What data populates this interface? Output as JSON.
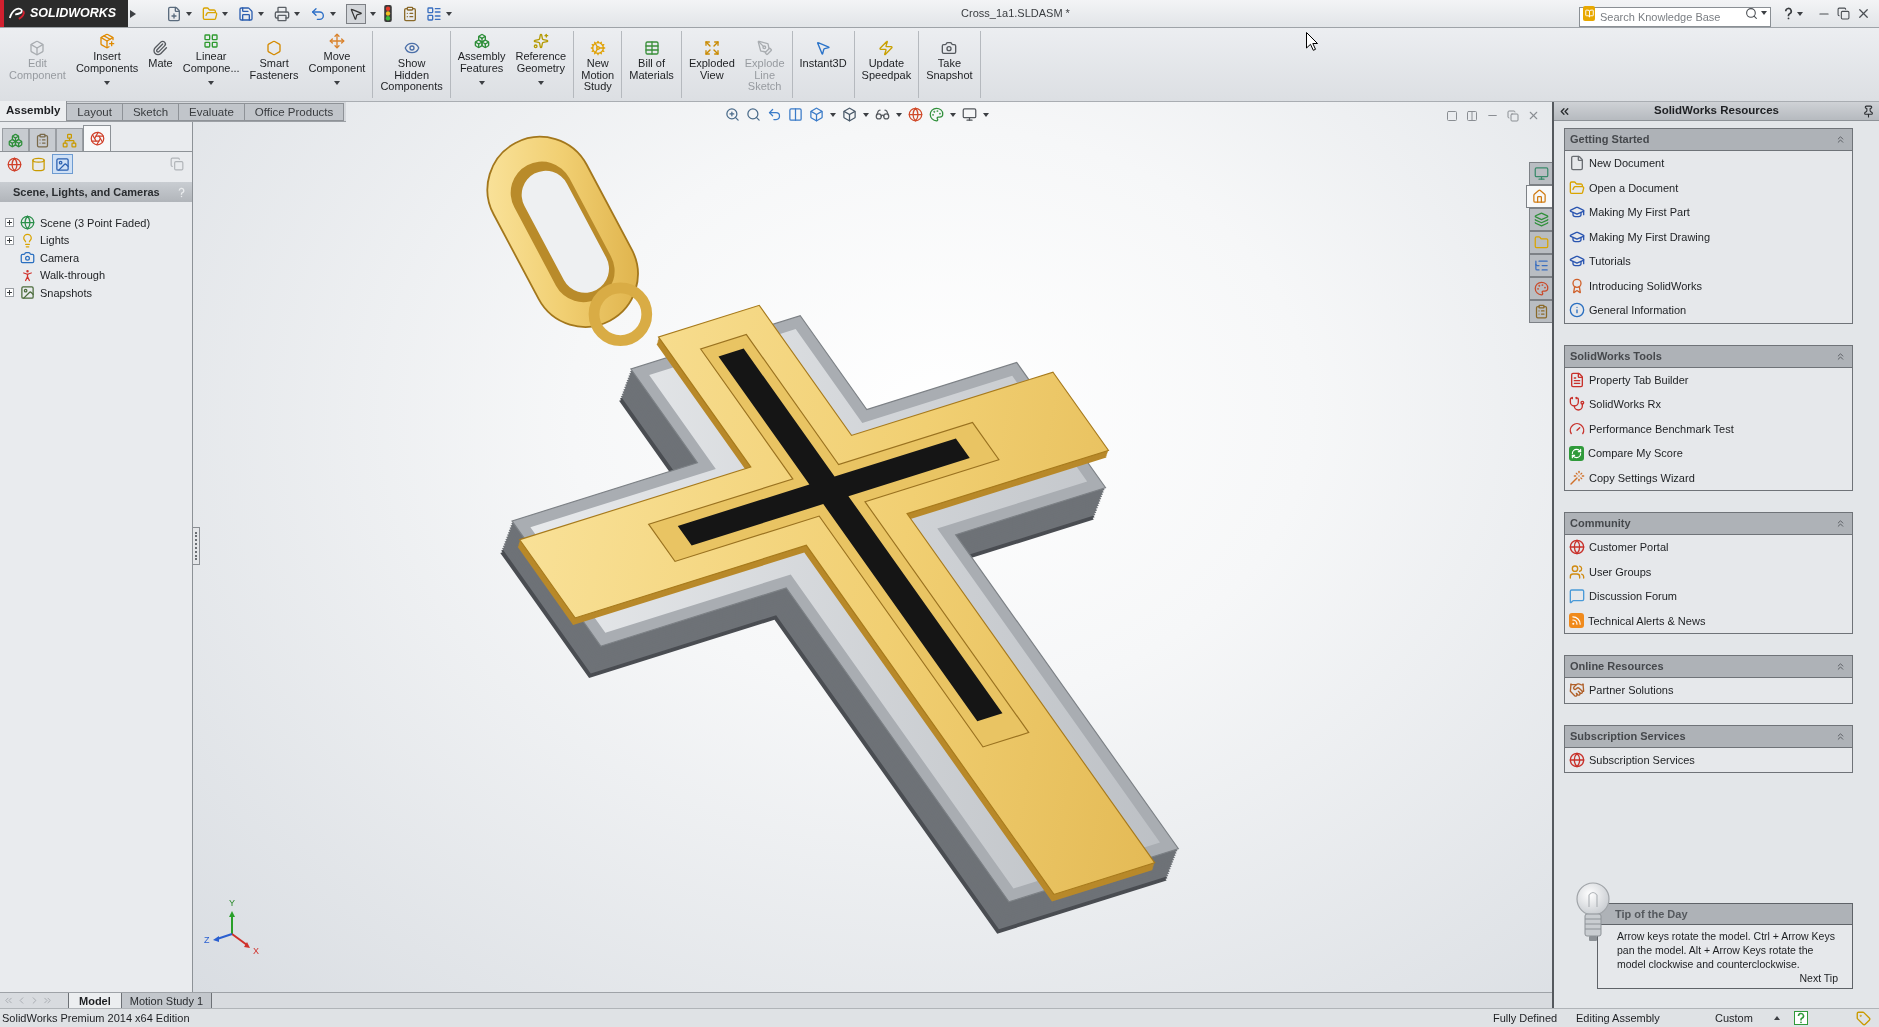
{
  "title_bar": {
    "logo": "SOLIDWORKS",
    "title": "Cross_1a1.SLDASM *",
    "select_tool": {
      "selected": true
    },
    "search": {
      "placeholder": "Search Knowledge Base"
    }
  },
  "command_groups": [
    {
      "buttons": [
        {
          "label": [
            "Edit",
            "Component"
          ],
          "disabled": true,
          "dropdown": false
        },
        {
          "label": [
            "Insert",
            "Components"
          ],
          "disabled": false,
          "dropdown": true
        },
        {
          "label": [
            "Mate"
          ],
          "disabled": false,
          "dropdown": false
        },
        {
          "label": [
            "Linear",
            "Compone..."
          ],
          "disabled": false,
          "dropdown": true
        },
        {
          "label": [
            "Smart",
            "Fasteners"
          ],
          "disabled": false,
          "dropdown": false
        },
        {
          "label": [
            "Move",
            "Component"
          ],
          "disabled": false,
          "dropdown": true
        }
      ]
    },
    {
      "buttons": [
        {
          "label": [
            "Show",
            "Hidden",
            "Components"
          ],
          "disabled": false,
          "dropdown": false
        }
      ]
    },
    {
      "buttons": [
        {
          "label": [
            "Assembly",
            "Features"
          ],
          "disabled": false,
          "dropdown": true
        },
        {
          "label": [
            "Reference",
            "Geometry"
          ],
          "disabled": false,
          "dropdown": true
        }
      ]
    },
    {
      "buttons": [
        {
          "label": [
            "New",
            "Motion",
            "Study"
          ],
          "disabled": false,
          "dropdown": false
        }
      ]
    },
    {
      "buttons": [
        {
          "label": [
            "Bill of",
            "Materials"
          ],
          "disabled": false,
          "dropdown": false
        }
      ]
    },
    {
      "buttons": [
        {
          "label": [
            "Exploded",
            "View"
          ],
          "disabled": false,
          "dropdown": false
        },
        {
          "label": [
            "Explode",
            "Line",
            "Sketch"
          ],
          "disabled": true,
          "dropdown": false
        }
      ]
    },
    {
      "buttons": [
        {
          "label": [
            "Instant3D"
          ],
          "disabled": false,
          "dropdown": false
        }
      ]
    },
    {
      "buttons": [
        {
          "label": [
            "Update",
            "Speedpak"
          ],
          "disabled": false,
          "dropdown": false
        }
      ]
    },
    {
      "buttons": [
        {
          "label": [
            "Take",
            "Snapshot"
          ],
          "disabled": false,
          "dropdown": false
        }
      ]
    }
  ],
  "command_tabs": [
    {
      "label": "Assembly",
      "selected": true
    },
    {
      "label": "Layout",
      "selected": false
    },
    {
      "label": "Sketch",
      "selected": false
    },
    {
      "label": "Evaluate",
      "selected": false
    },
    {
      "label": "Office Products",
      "selected": false
    }
  ],
  "left_panel": {
    "tabs": [
      {
        "selected": false
      },
      {
        "selected": false
      },
      {
        "selected": false
      },
      {
        "selected": true
      }
    ],
    "view_buttons": [
      {
        "selected": false
      },
      {
        "selected": false
      },
      {
        "selected": true
      }
    ],
    "header": "Scene, Lights, and Cameras",
    "tree": [
      {
        "label": "Scene (3 Point Faded)",
        "expandable": true,
        "expanded": false
      },
      {
        "label": "Lights",
        "expandable": true,
        "expanded": false
      },
      {
        "label": "Camera",
        "expandable": false
      },
      {
        "label": "Walk-through",
        "expandable": false
      },
      {
        "label": "Snapshots",
        "expandable": true,
        "expanded": false
      }
    ]
  },
  "viewport": {
    "triad": {
      "y": "Y",
      "z": "Z",
      "x": "X"
    }
  },
  "bottom_tabs": [
    {
      "label": "Model",
      "selected": true
    },
    {
      "label": "Motion Study 1",
      "selected": false
    }
  ],
  "task_pane": {
    "tabs": [
      {
        "selected": false
      },
      {
        "selected": true
      },
      {
        "selected": false
      },
      {
        "selected": false
      },
      {
        "selected": false
      },
      {
        "selected": false
      },
      {
        "selected": false
      }
    ],
    "title": "SolidWorks Resources",
    "sections": [
      {
        "title": "Getting Started",
        "expanded": true,
        "items": [
          "New Document",
          "Open a Document",
          "Making My First Part",
          "Making My First Drawing",
          "Tutorials",
          "Introducing SolidWorks",
          "General Information"
        ]
      },
      {
        "title": "SolidWorks Tools",
        "expanded": true,
        "items": [
          "Property Tab Builder",
          "SolidWorks Rx",
          "Performance Benchmark Test",
          "Compare My Score",
          "Copy Settings Wizard"
        ]
      },
      {
        "title": "Community",
        "expanded": true,
        "items": [
          "Customer Portal",
          "User Groups",
          "Discussion Forum",
          "Technical Alerts & News"
        ]
      },
      {
        "title": "Online Resources",
        "expanded": true,
        "items": [
          "Partner Solutions"
        ]
      },
      {
        "title": "Subscription Services",
        "expanded": true,
        "items": [
          "Subscription Services"
        ]
      }
    ],
    "tip": {
      "title": "Tip of the Day",
      "text": "Arrow keys rotate the model. Ctrl + Arrow Keys pan the model. Alt + Arrow Keys rotate the model clockwise and counterclockwise.",
      "link": "Next Tip"
    }
  },
  "status_bar": {
    "edition": "SolidWorks Premium 2014 x64 Edition",
    "state": "Fully Defined",
    "mode": "Editing Assembly",
    "units": "Custom"
  }
}
